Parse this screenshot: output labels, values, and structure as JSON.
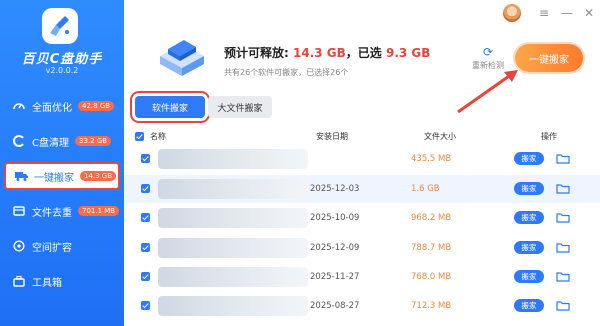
{
  "app": {
    "name": "百贝C盘助手",
    "version": "v2.0.0.2"
  },
  "nav": [
    {
      "label": "全面优化",
      "badge": "42.8 GB",
      "icon": "gauge-icon"
    },
    {
      "label": "C盘清理",
      "badge": "33.2 GB",
      "icon": "c-drive-icon"
    },
    {
      "label": "一键搬家",
      "badge": "14.3 GB",
      "icon": "truck-icon",
      "active": true
    },
    {
      "label": "文件去重",
      "badge": "701.1 MB",
      "icon": "files-icon"
    },
    {
      "label": "空间扩容",
      "badge": "",
      "icon": "expand-icon"
    },
    {
      "label": "工具箱",
      "badge": "",
      "icon": "toolbox-icon"
    }
  ],
  "summary": {
    "release_prefix": "预计可释放:",
    "release_value": "14.3 GB",
    "selected_prefix": "，已选",
    "selected_value": "9.3 GB",
    "sub": "共有26个软件可搬家，已选择26个"
  },
  "actions": {
    "recheck": "重新检测",
    "one_click": "一键搬家"
  },
  "tabs": [
    "软件搬家",
    "大文件搬家"
  ],
  "table": {
    "headers": {
      "name": "名称",
      "date": "安装日期",
      "size": "文件大小",
      "ops": "操作"
    },
    "rows": [
      {
        "date": "",
        "size": "435.5 MB",
        "btn": "搬家"
      },
      {
        "date": "2025-12-03",
        "size": "1.6 GB",
        "btn": "搬家"
      },
      {
        "date": "2025-10-09",
        "size": "968.2 MB",
        "btn": "搬家"
      },
      {
        "date": "2025-12-09",
        "size": "788.7 MB",
        "btn": "搬家"
      },
      {
        "date": "2025-11-27",
        "size": "768.0 MB",
        "btn": "搬家"
      },
      {
        "date": "2025-08-27",
        "size": "712.3 MB",
        "btn": "搬家"
      }
    ]
  },
  "colors": {
    "primary": "#2f7af8",
    "accent": "#ff7a2e",
    "danger": "#e8453c"
  }
}
